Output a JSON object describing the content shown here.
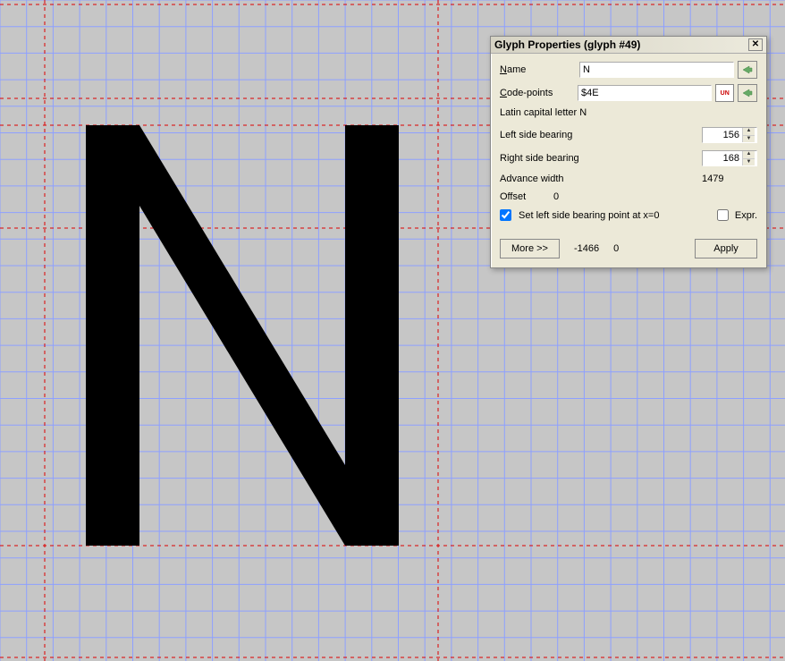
{
  "dialog": {
    "title": "Glyph Properties (glyph #49)",
    "name_label": "Name",
    "name_value": "N",
    "code_label": "Code-points",
    "code_value": "$4E",
    "description": "Latin capital letter N",
    "lsb_label": "Left side bearing",
    "lsb_value": "156",
    "rsb_label": "Right side bearing",
    "rsb_value": "168",
    "adv_label": "Advance width",
    "adv_value": "1479",
    "offset_label": "Offset",
    "offset_value": "0",
    "set_lsb_label": "Set left side bearing point at x=0",
    "expr_label": "Expr.",
    "more_label": "More >>",
    "num1": "-1466",
    "num2": "0",
    "apply_label": "Apply"
  },
  "underlines": {
    "name": "N",
    "code": "C",
    "lsb": "L",
    "rsb": "R",
    "set": "S",
    "expr": "E",
    "more": "M",
    "apply": "A"
  }
}
